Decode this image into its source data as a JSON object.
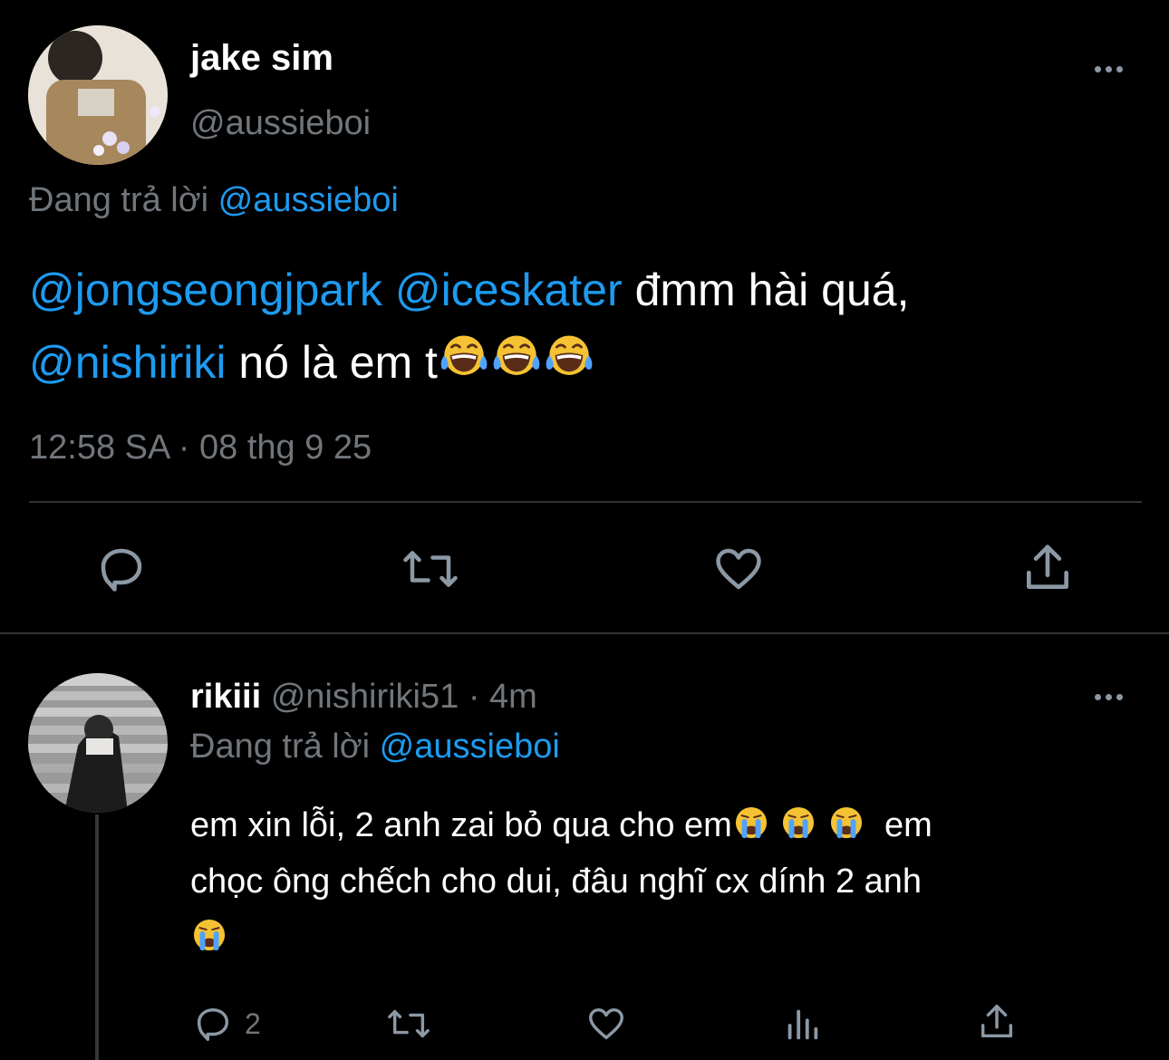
{
  "main_tweet": {
    "display_name": "jake sim",
    "handle": "@aussieboi",
    "reply_prefix": "Đang trả lời",
    "reply_to": "@aussieboi",
    "body": {
      "mention1": "@jongseongjpark",
      "mention2": "@iceskater",
      "text1": "đmm hài quá,",
      "mention3": "@nishiriki",
      "text2": "nó là em t"
    },
    "emoji": "laughing-tears x3",
    "timestamp": "12:58 SA · 08 thg 9 25",
    "actions": [
      "reply-icon",
      "retweet-icon",
      "like-icon",
      "share-icon"
    ]
  },
  "reply_tweet": {
    "display_name": "rikiii",
    "handle": "@nishiriki51",
    "separator": "·",
    "time": "4m",
    "reply_prefix": "Đang trả lời",
    "reply_to": "@aussieboi",
    "body_line1": "em xin lỗi, 2 anh zai bỏ qua cho em",
    "body_line1_tail": "em",
    "body_line2": "chọc ông chếch cho dui, đâu nghĩ cx dính 2 anh",
    "emoji": "crying x4",
    "reply_count": "2",
    "actions": [
      "reply-icon",
      "retweet-icon",
      "like-icon",
      "views-icon",
      "share-icon"
    ]
  },
  "colors": {
    "background": "#000000",
    "text": "#e7e9ea",
    "muted": "#71767b",
    "link": "#1d9bf0",
    "divider": "#2f3336"
  }
}
